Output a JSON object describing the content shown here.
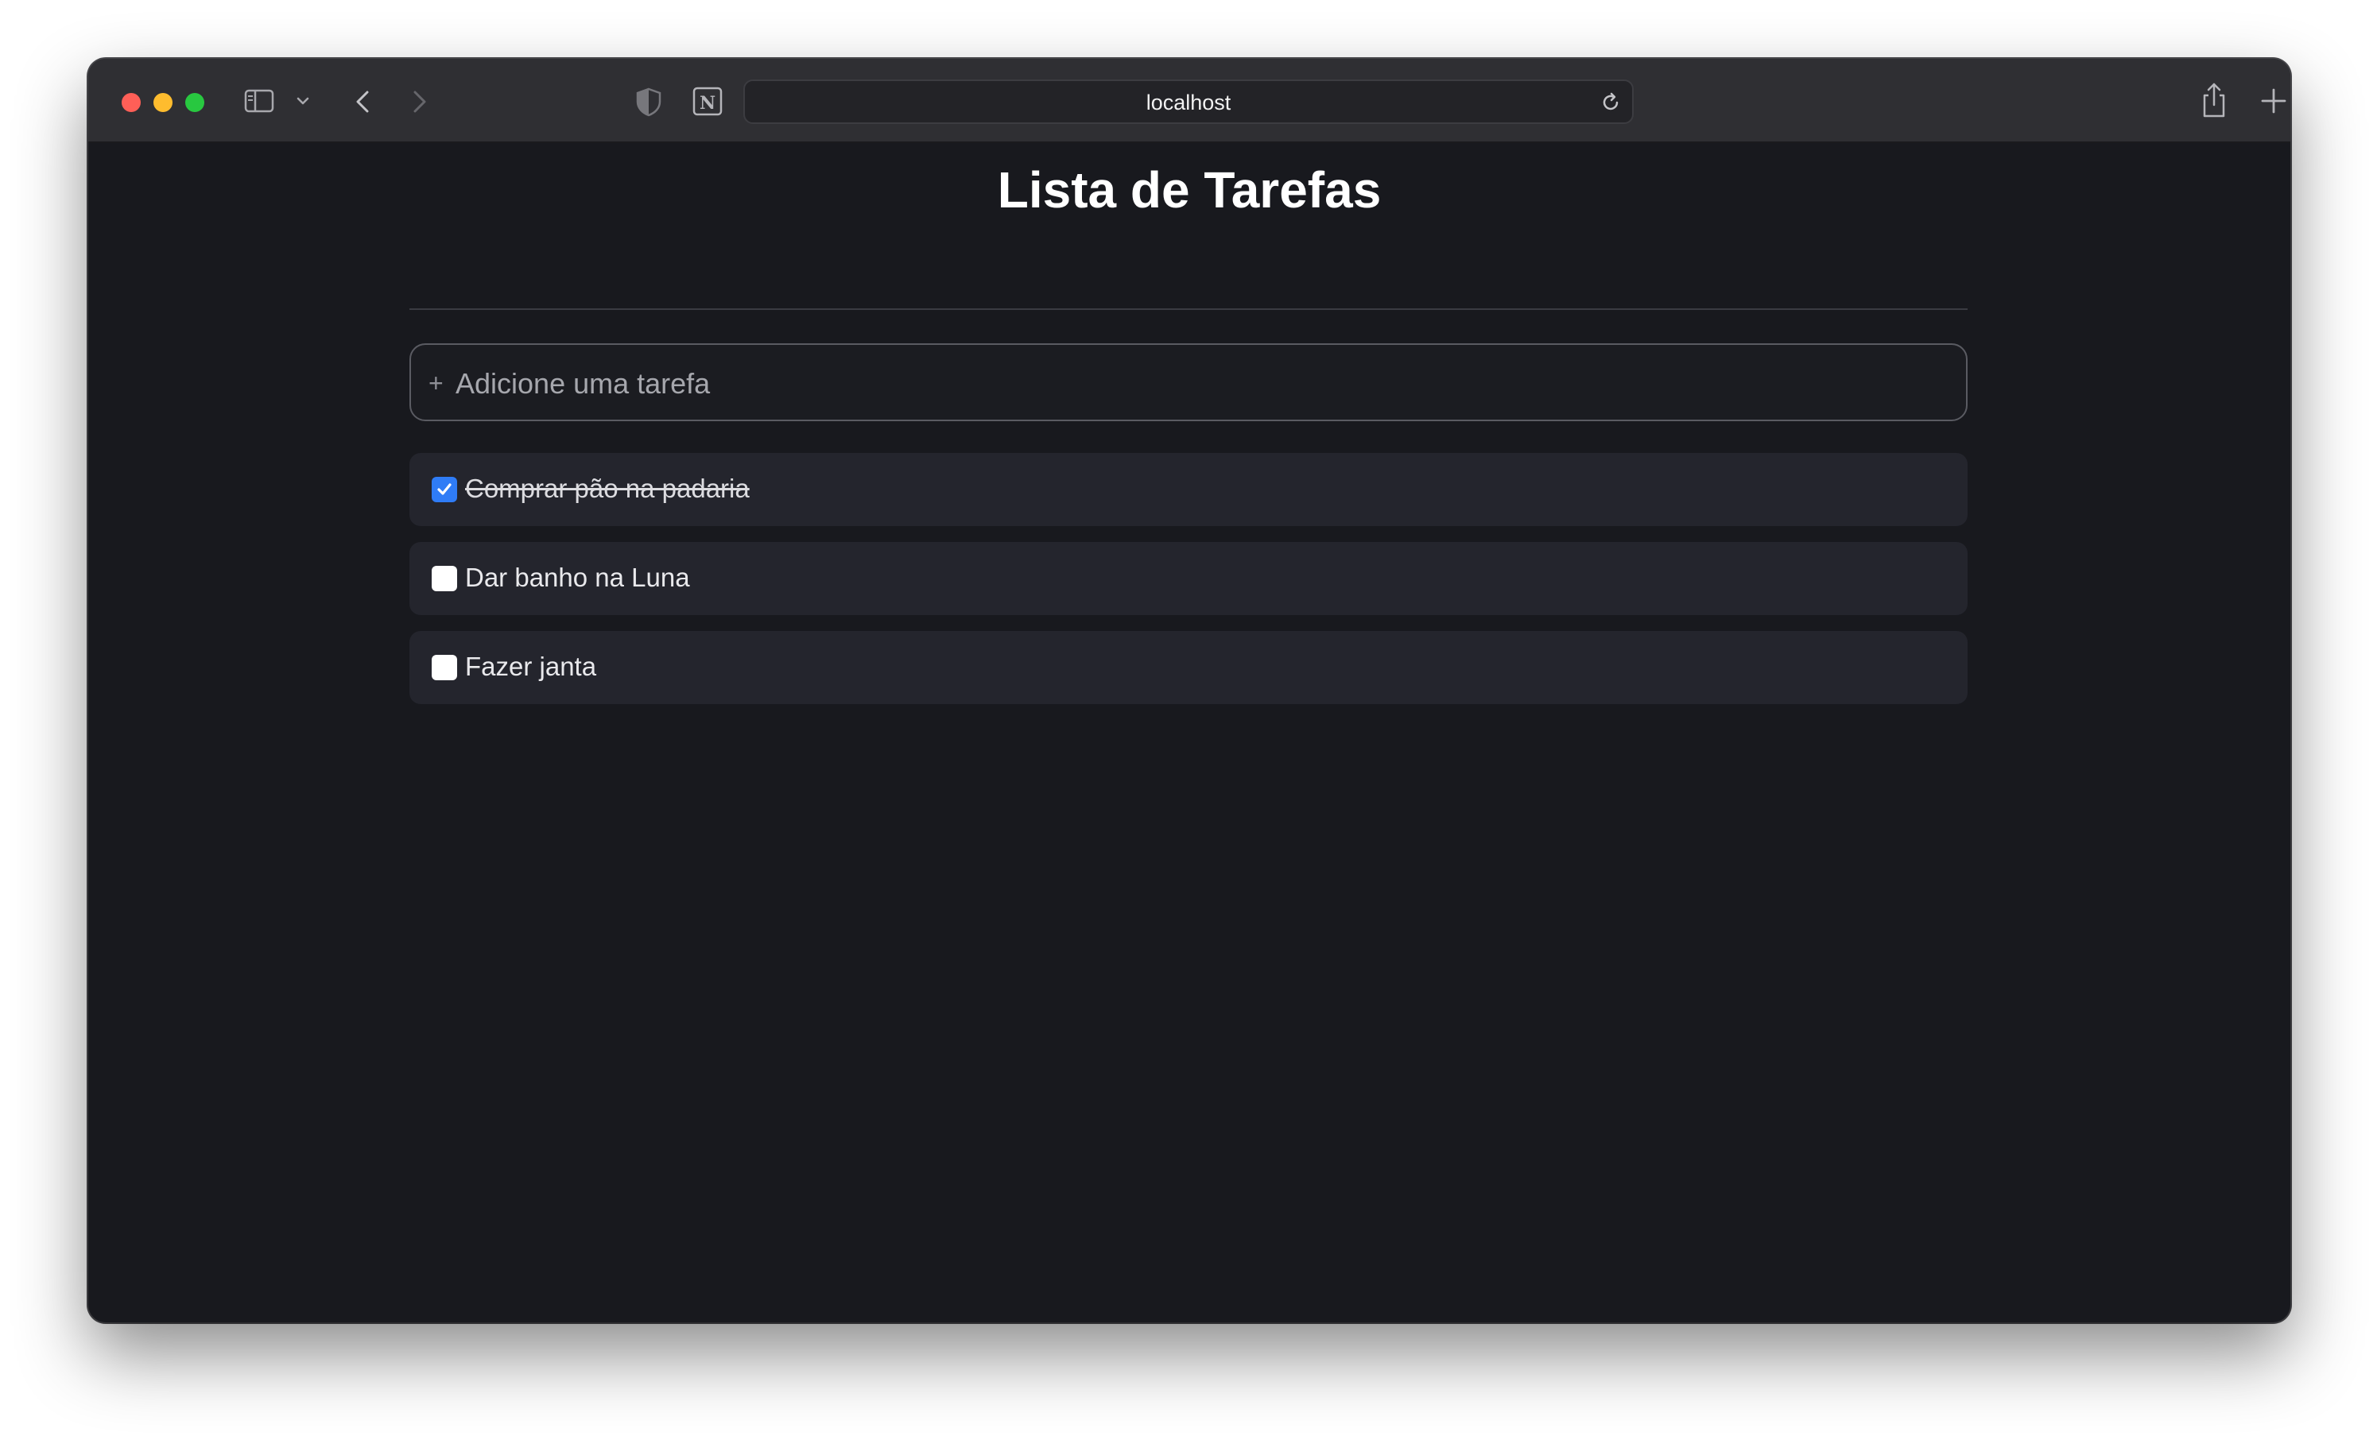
{
  "browser": {
    "url": "localhost",
    "icons": [
      "sidebar-icon",
      "chevron-down-icon",
      "back-icon",
      "forward-icon",
      "shield-icon",
      "notion-icon",
      "reload-icon",
      "share-icon",
      "new-tab-icon",
      "tab-overview-icon"
    ]
  },
  "page": {
    "title": "Lista de Tarefas",
    "add_task_placeholder": "Adicione uma tarefa",
    "add_icon": "+"
  },
  "tasks": [
    {
      "label": "Comprar pão na padaria",
      "done": true
    },
    {
      "label": "Dar banho na Luna",
      "done": false
    },
    {
      "label": "Fazer janta",
      "done": false
    }
  ],
  "colors": {
    "background": "#18191e",
    "task_background": "#24252d",
    "checkbox_checked": "#2f7cf6"
  }
}
